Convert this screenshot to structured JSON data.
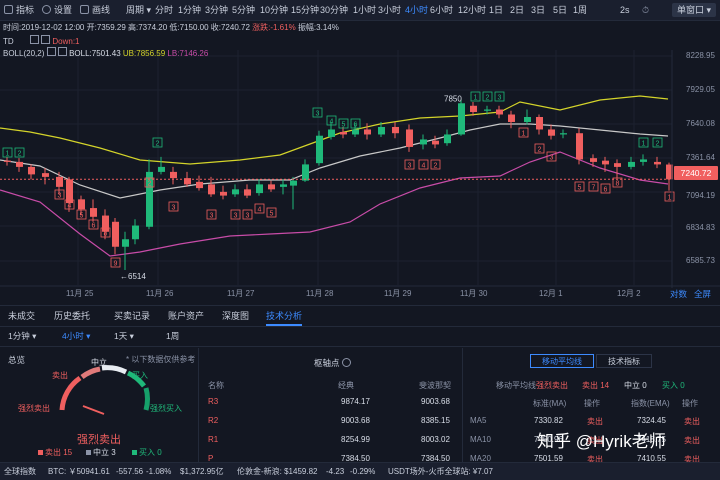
{
  "toolbar": {
    "items": [
      "指标",
      "设置",
      "画线"
    ],
    "period_label": "周期",
    "intervals": [
      "分时",
      "1分钟",
      "3分钟",
      "5分钟",
      "10分钟",
      "15分钟",
      "30分钟",
      "1小时",
      "3小时",
      "4小时",
      "6小时",
      "12小时",
      "1日",
      "2日",
      "3日",
      "5日",
      "1周"
    ],
    "active_interval": "4小时",
    "refresh": "2s",
    "single_window": "单窗口"
  },
  "chart": {
    "info_time": "时间:2019-12-02 12:00",
    "info_open": "开:7359.29",
    "info_high": "高:7374.20",
    "info_low": "低:7150.00",
    "info_close": "收:7240.72",
    "info_change": "涨跌:-1.61%",
    "info_amp": "振幅:3.14%",
    "td_label": "TD",
    "td_down": "Down:1",
    "boll_label": "BOLL(20,2)",
    "boll_mid": "BOLL:7501.43",
    "boll_ub": "UB:7856.59",
    "boll_lb": "LB:7146.26",
    "price_ticks": [
      "8228.95",
      "7929.05",
      "7640.08",
      "7361.64",
      "7240.72",
      "7094.19",
      "6834.83",
      "6585.73"
    ],
    "current_price": "7240.72",
    "date_ticks": [
      "11月 25",
      "11月 26",
      "11月 27",
      "11月 28",
      "11月 29",
      "11月 30",
      "12月 1",
      "12月 2"
    ],
    "high_marker": "7850",
    "low_marker": "6514",
    "log_link": "对数",
    "full_link": "全屏"
  },
  "tabs": [
    "未成交",
    "历史委托",
    "买卖记录",
    "账户资产",
    "深度图",
    "技术分析"
  ],
  "active_tab": "技术分析",
  "subtabs": {
    "a": "1分钟",
    "b": "4小时",
    "c": "1天",
    "d": "1周"
  },
  "summary": {
    "title": "总览",
    "note": "* 以下数据仅供参考",
    "neutral": "中立",
    "sell": "卖出",
    "buy": "买入",
    "strong_sell": "强烈卖出",
    "strong_buy": "强烈买入",
    "verdict": "强烈卖出",
    "sell_count": "卖出 15",
    "neutral_count": "中立 3",
    "buy_count": "买入 0"
  },
  "pivot": {
    "title": "枢轴点",
    "col_classic": "经典",
    "col_fib": "斐波那契",
    "rows": [
      {
        "name": "R3",
        "classic": "9874.17",
        "fib": "9003.68"
      },
      {
        "name": "R2",
        "classic": "9003.68",
        "fib": "8385.15"
      },
      {
        "name": "R1",
        "classic": "8254.99",
        "fib": "8003.02"
      },
      {
        "name": "P",
        "classic": "7384.50",
        "fib": "7384.50"
      }
    ]
  },
  "ma": {
    "tab_ma": "移动平均线",
    "tab_tech": "技术指标",
    "summary_label": "移动平均线",
    "summary_value": "强烈卖出",
    "sell": "卖出 14",
    "neutral": "中立 0",
    "buy": "买入 0",
    "col_ma": "标准(MA)",
    "col_op": "操作",
    "col_ema": "指数(EMA)",
    "col_op2": "操作",
    "rows": [
      {
        "name": "MA5",
        "ma": "7330.82",
        "op": "卖出",
        "ema": "7324.45",
        "op2": "卖出"
      },
      {
        "name": "MA10",
        "ma": "7450.96",
        "op": "卖出",
        "ema": "7418.75",
        "op2": "卖出"
      },
      {
        "name": "MA20",
        "ma": "7501.59",
        "op": "卖出",
        "ema": "7410.55",
        "op2": "卖出"
      }
    ]
  },
  "status": {
    "index_label": "全球指数",
    "btc": "BTC: ￥50941.61",
    "btc_change": "-557.56",
    "btc_pct": "-1.08%",
    "btc_usd": "$1,372.95亿",
    "ltc": "伦敦金-新浪: $1459.82",
    "ltc_change": "-4.23",
    "ltc_pct": "-0.29%",
    "usdt": "USDT场外-火币全球站: ¥7.07"
  },
  "watermark": "知乎 @Hyrik老师",
  "colors": {
    "up": "#1fb97a",
    "down": "#f05f5f",
    "accent": "#3d8bff",
    "boll_ub": "#d4d42a",
    "boll_lb": "#c84ca8",
    "boll_mid": "#c8c8c8"
  }
}
